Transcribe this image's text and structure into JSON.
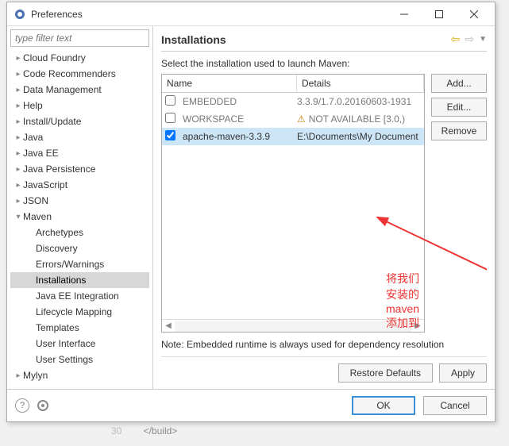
{
  "window": {
    "title": "Preferences"
  },
  "filter": {
    "placeholder": "type filter text"
  },
  "tree": {
    "items": [
      {
        "label": "Cloud Foundry",
        "twist": ">",
        "level": 0
      },
      {
        "label": "Code Recommenders",
        "twist": ">",
        "level": 0
      },
      {
        "label": "Data Management",
        "twist": ">",
        "level": 0
      },
      {
        "label": "Help",
        "twist": ">",
        "level": 0
      },
      {
        "label": "Install/Update",
        "twist": ">",
        "level": 0
      },
      {
        "label": "Java",
        "twist": ">",
        "level": 0
      },
      {
        "label": "Java EE",
        "twist": ">",
        "level": 0
      },
      {
        "label": "Java Persistence",
        "twist": ">",
        "level": 0
      },
      {
        "label": "JavaScript",
        "twist": ">",
        "level": 0
      },
      {
        "label": "JSON",
        "twist": ">",
        "level": 0
      },
      {
        "label": "Maven",
        "twist": "v",
        "level": 0
      },
      {
        "label": "Archetypes",
        "twist": "",
        "level": 1
      },
      {
        "label": "Discovery",
        "twist": "",
        "level": 1
      },
      {
        "label": "Errors/Warnings",
        "twist": "",
        "level": 1
      },
      {
        "label": "Installations",
        "twist": "",
        "level": 1,
        "selected": true
      },
      {
        "label": "Java EE Integration",
        "twist": "",
        "level": 1
      },
      {
        "label": "Lifecycle Mapping",
        "twist": "",
        "level": 1
      },
      {
        "label": "Templates",
        "twist": "",
        "level": 1
      },
      {
        "label": "User Interface",
        "twist": "",
        "level": 1
      },
      {
        "label": "User Settings",
        "twist": "",
        "level": 1
      },
      {
        "label": "Mylyn",
        "twist": ">",
        "level": 0
      }
    ]
  },
  "page": {
    "title": "Installations",
    "instruction": "Select the installation used to launch Maven:",
    "columns": {
      "name": "Name",
      "details": "Details"
    },
    "rows": [
      {
        "checked": false,
        "name": "EMBEDDED",
        "details": "3.3.9/1.7.0.20160603-1931",
        "warn": false,
        "sel": false
      },
      {
        "checked": false,
        "name": "WORKSPACE",
        "details": "NOT AVAILABLE [3.0,)",
        "warn": true,
        "sel": false
      },
      {
        "checked": true,
        "name": "apache-maven-3.3.9",
        "details": "E:\\Documents\\My Document",
        "warn": false,
        "sel": true
      }
    ],
    "buttons": {
      "add": "Add...",
      "edit": "Edit...",
      "remove": "Remove"
    },
    "note": "Note: Embedded runtime is always used for dependency resolution",
    "restore": "Restore Defaults",
    "apply": "Apply"
  },
  "footer": {
    "ok": "OK",
    "cancel": "Cancel"
  },
  "annotation": "将我们安装的 maven 添加到这里",
  "below": {
    "ln": "30",
    "code": "</build>"
  }
}
